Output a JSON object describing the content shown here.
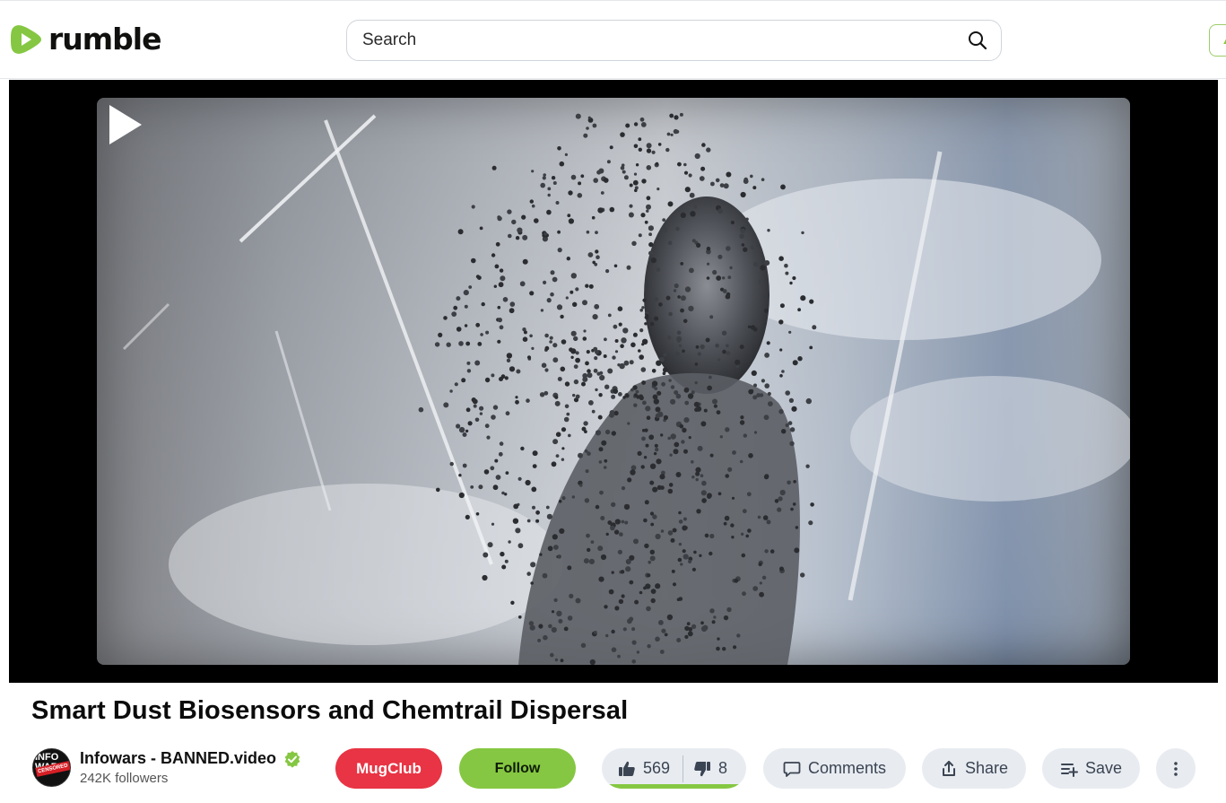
{
  "header": {
    "logo_text": "rumble",
    "search_placeholder": "Search",
    "brand_color": "#85c742"
  },
  "video": {
    "title": "Smart Dust Biosensors and Chemtrail Dispersal",
    "play_icon": "play-icon"
  },
  "channel": {
    "name": "Infowars - BANNED.video",
    "followers": "242K followers",
    "verified_icon": "verified-check-icon",
    "avatar_text": "INFO WARS",
    "avatar_stamp": "CENSORED"
  },
  "actions": {
    "mugclub_label": "MugClub",
    "follow_label": "Follow",
    "likes": "569",
    "dislikes": "8",
    "like_ratio": 0.986,
    "comments_label": "Comments",
    "share_label": "Share",
    "save_label": "Save",
    "more_icon": "more-vertical-icon"
  },
  "colors": {
    "mugclub": "#e83444",
    "follow": "#85c742",
    "pill_bg": "#e8ecf1"
  }
}
